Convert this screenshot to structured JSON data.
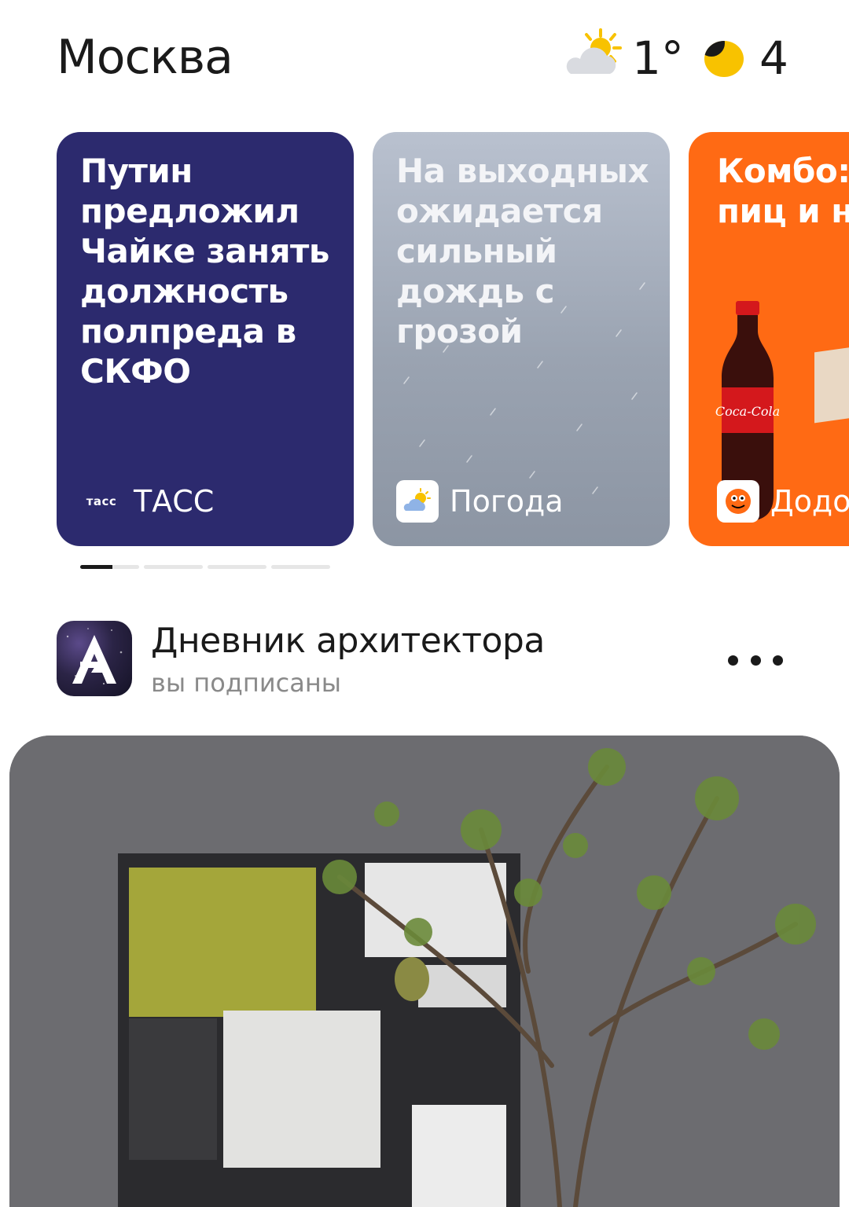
{
  "header": {
    "city": "Москва",
    "weather_icon": "partly-cloudy-icon",
    "temperature": "1°",
    "traffic_icon": "traffic-score-icon",
    "traffic_score": "4"
  },
  "stories": [
    {
      "title": "Путин предложил Чайке занять должность полпреда в СКФО",
      "source": "ТАСС",
      "source_logo_text": "тасс",
      "background": "#2c2a6e"
    },
    {
      "title": "На выходных ожидается сильный дождь с грозой",
      "source": "Погода",
      "background": "#a3abb9"
    },
    {
      "title": "Комбо: две пиц и напит",
      "source": "Додо",
      "background": "#ff6a14"
    }
  ],
  "story_progress": {
    "count": 4,
    "active_index": 0,
    "active_fraction": 0.55
  },
  "channel": {
    "name": "Дневник архитектора",
    "subscription_status": "вы подписаны",
    "avatar_letter": "A"
  }
}
